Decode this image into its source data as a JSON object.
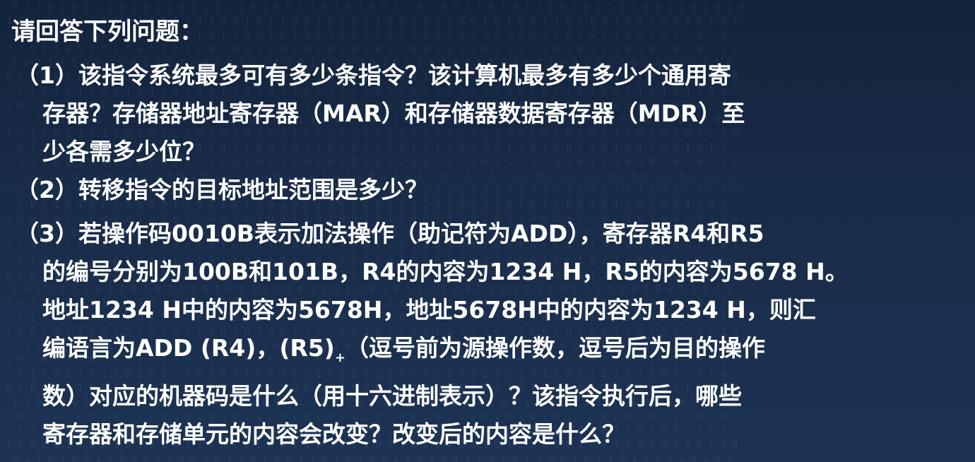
{
  "heading": "请回答下列问题：",
  "q1": {
    "lines": [
      "（1）该指令系统最多可有多少条指令？该计算机最多有多少个通用寄",
      "存器？存储器地址寄存器（MAR）和存储器数据寄存器（MDR）至",
      "少各需多少位？"
    ]
  },
  "q2": {
    "lines": [
      "（2）转移指令的目标地址范围是多少？"
    ]
  },
  "q3": {
    "lines": [
      "（3）若操作码0010B表示加法操作（助记符为ADD），寄存器R4和R5",
      "的编号分别为100B和101B，R4的内容为1234 H，R5的内容为5678 H。",
      "地址1234 H中的内容为5678H，地址5678H中的内容为1234 H，则汇"
    ],
    "line4_pre": "编语言为ADD (R4)，(R5)",
    "line4_sub": "+",
    "line4_post": "（逗号前为源操作数，逗号后为目的操作",
    "lines_after": [
      "数）对应的机器码是什么（用十六进制表示）？该指令执行后，哪些",
      "寄存器和存储单元的内容会改变？改变后的内容是什么？"
    ]
  }
}
